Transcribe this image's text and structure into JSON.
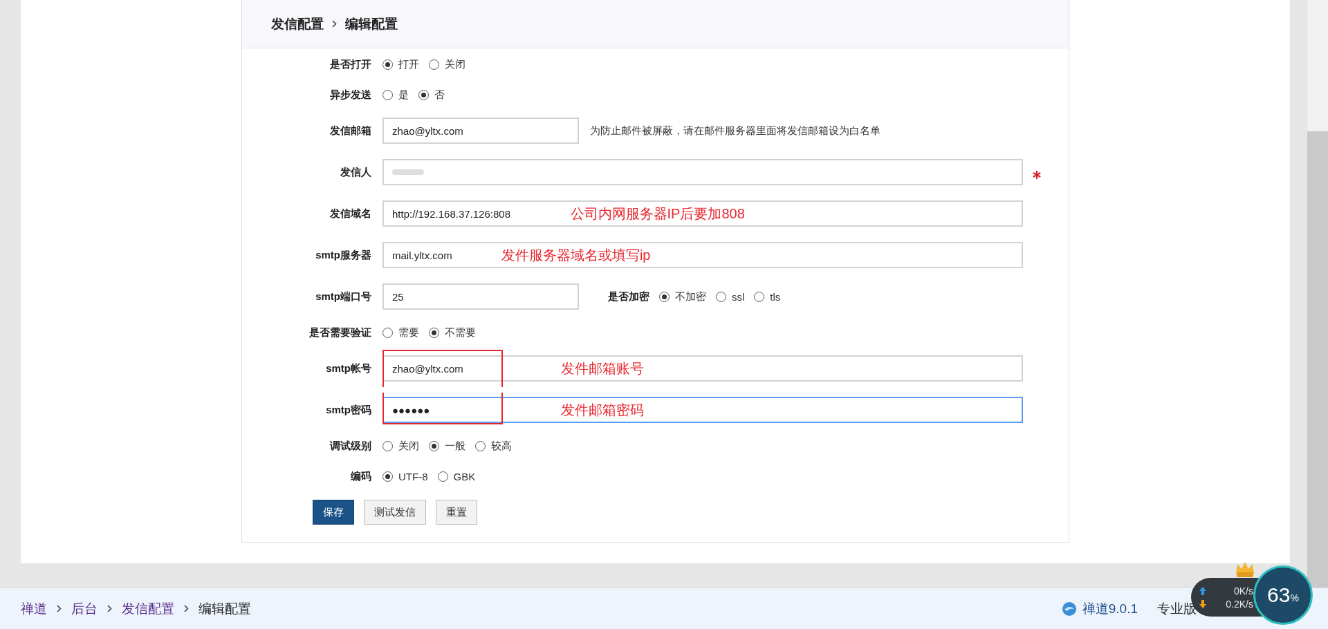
{
  "header": {
    "crumbs": [
      "发信配置",
      "编辑配置"
    ]
  },
  "rows": [
    {
      "kind": "radio",
      "label": "是否打开",
      "options": [
        {
          "label": "打开",
          "selected": true
        },
        {
          "label": "关闭",
          "selected": false
        }
      ]
    },
    {
      "kind": "radio",
      "label": "异步发送",
      "options": [
        {
          "label": "是",
          "selected": false
        },
        {
          "label": "否",
          "selected": true
        }
      ]
    },
    {
      "kind": "short_input",
      "label": "发信邮箱",
      "value": "zhao@yltx.com",
      "hint": "为防止邮件被屏蔽，请在邮件服务器里面将发信邮箱设为白名单"
    },
    {
      "kind": "input",
      "label": "发信人",
      "blurred": true,
      "required": true
    },
    {
      "kind": "input",
      "label": "发信域名",
      "value": "http://192.168.37.126:808",
      "note": "公司内网服务器IP后要加808"
    },
    {
      "kind": "input",
      "label": "smtp服务器",
      "value": "mail.yltx.com",
      "note": "发件服务器域名或填写ip"
    },
    {
      "kind": "input_radio",
      "label": "smtp端口号",
      "value": "25",
      "side_label": "是否加密",
      "options": [
        {
          "label": "不加密",
          "selected": true
        },
        {
          "label": "ssl",
          "selected": false
        },
        {
          "label": "tls",
          "selected": false
        }
      ]
    },
    {
      "kind": "radio",
      "label": "是否需要验证",
      "options": [
        {
          "label": "需要",
          "selected": false
        },
        {
          "label": "不需要",
          "selected": true
        }
      ]
    },
    {
      "kind": "input",
      "label": "smtp帐号",
      "value": "zhao@yltx.com",
      "note": "发件邮箱账号",
      "outlined": true
    },
    {
      "kind": "input",
      "label": "smtp密码",
      "value": "●●●●●●",
      "note": "发件邮箱密码",
      "outlined": true,
      "focused": true
    },
    {
      "kind": "radio",
      "label": "调试级别",
      "options": [
        {
          "label": "关闭",
          "selected": false
        },
        {
          "label": "一般",
          "selected": true
        },
        {
          "label": "较高",
          "selected": false
        }
      ]
    },
    {
      "kind": "radio",
      "label": "编码",
      "options": [
        {
          "label": "UTF-8",
          "selected": true
        },
        {
          "label": "GBK",
          "selected": false
        }
      ]
    }
  ],
  "buttons": [
    {
      "label": "保存",
      "kind": "primary"
    },
    {
      "label": "测试发信",
      "kind": "default"
    },
    {
      "label": "重置",
      "kind": "default"
    }
  ],
  "footer": {
    "breadcrumbs": [
      {
        "label": "禅道",
        "link": true
      },
      {
        "label": "后台",
        "link": true
      },
      {
        "label": "发信配置",
        "link": true
      },
      {
        "label": "编辑配置",
        "link": false
      }
    ],
    "version": "禅道9.0.1",
    "edition": "专业版"
  },
  "speed_widget": {
    "upload": "0K/s",
    "download": "0.2K/s",
    "percent": "63",
    "unit": "%"
  }
}
